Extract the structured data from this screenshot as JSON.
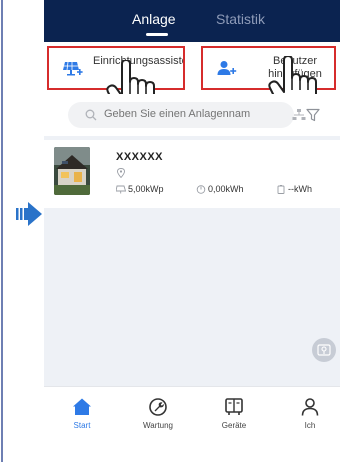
{
  "header": {
    "tabs": [
      {
        "label": "Anlage",
        "active": true
      },
      {
        "label": "Statistik",
        "active": false
      }
    ]
  },
  "actions": {
    "setup_wizard_label": "Einrichtungsassistent",
    "add_user_label": "Benutzer hinzufügen"
  },
  "search": {
    "placeholder": "Geben Sie einen Anlagennam"
  },
  "plant": {
    "name": "XXXXXX",
    "capacity": "5,00kWp",
    "energy": "0,00kWh",
    "battery": "--kWh"
  },
  "nav": {
    "items": [
      {
        "label": "Start",
        "icon": "home-icon",
        "active": true
      },
      {
        "label": "Wartung",
        "icon": "wrench-icon",
        "active": false
      },
      {
        "label": "Geräte",
        "icon": "device-icon",
        "active": false
      },
      {
        "label": "Ich",
        "icon": "person-icon",
        "active": false
      }
    ]
  },
  "colors": {
    "header_bg": "#0b2350",
    "accent_blue": "#2e7ae6",
    "highlight_red": "#d62c2c",
    "content_bg": "#eef1f6",
    "arrow_blue": "#2a73c9"
  }
}
